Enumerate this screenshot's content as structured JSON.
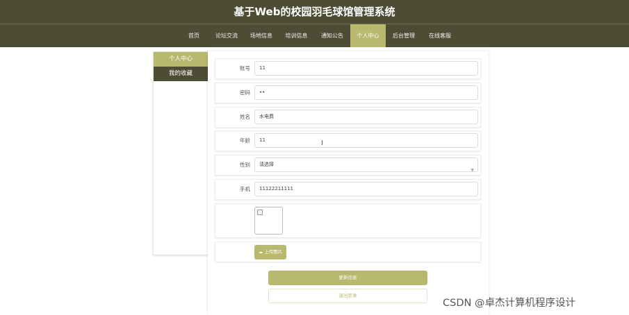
{
  "header": {
    "title": "基于Web的校园羽毛球馆管理系统"
  },
  "nav": {
    "items": [
      {
        "label": "首页"
      },
      {
        "label": "论坛交流"
      },
      {
        "label": "场地信息"
      },
      {
        "label": "培训信息"
      },
      {
        "label": "通知公告"
      },
      {
        "label": "个人中心",
        "active": true
      },
      {
        "label": "后台管理"
      },
      {
        "label": "在线客服"
      }
    ]
  },
  "sidebar": {
    "title": "个人中心",
    "items": [
      {
        "label": "我的收藏"
      }
    ]
  },
  "form": {
    "account": {
      "label": "账号",
      "value": "11"
    },
    "password": {
      "label": "密码",
      "value": "••"
    },
    "name": {
      "label": "姓名",
      "value": "水电费"
    },
    "age": {
      "label": "年龄",
      "value": "11"
    },
    "gender": {
      "label": "性别",
      "value": "请选择"
    },
    "phone": {
      "label": "手机",
      "value": "11122211111"
    },
    "upload_label": "上传图片"
  },
  "buttons": {
    "update": "更新信息",
    "logout": "退出登录"
  },
  "watermark": "CSDN @卓杰计算机程序设计",
  "colors": {
    "header_bg": "#4d4c34",
    "accent": "#b9b86f"
  }
}
